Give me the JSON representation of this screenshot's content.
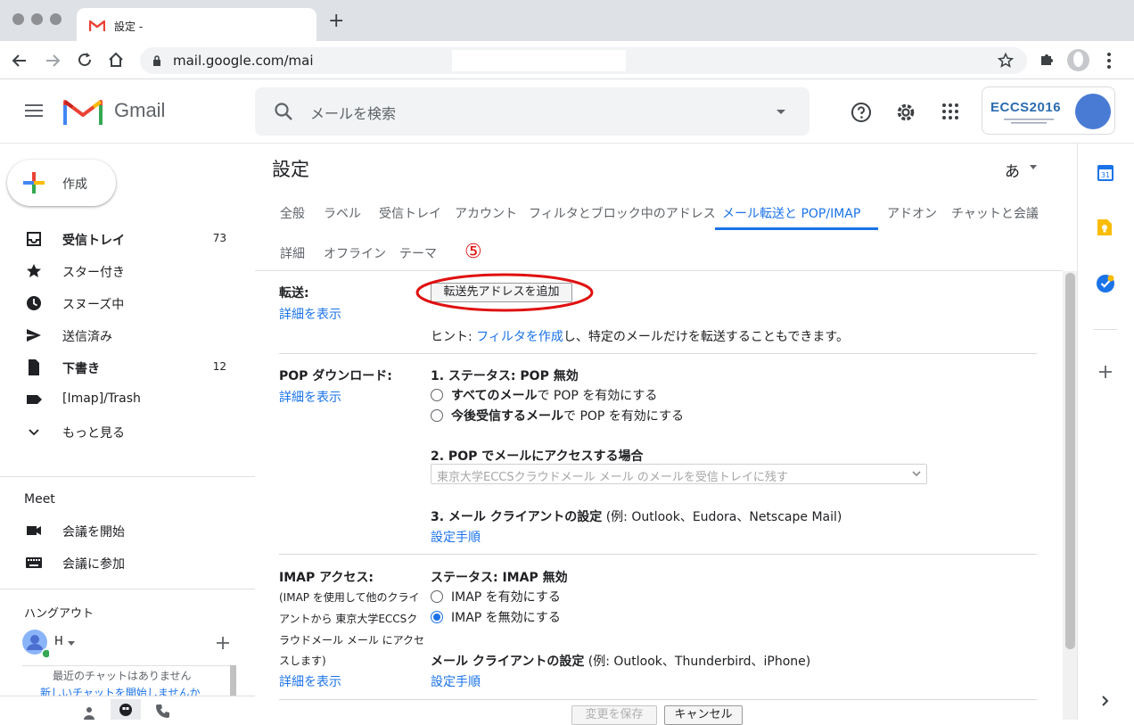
{
  "browser": {
    "tab_title": "設定 -",
    "new_tab": "+",
    "url": "mail.google.com/mai"
  },
  "gmail": {
    "product_name": "Gmail",
    "search_placeholder": "メールを検索",
    "account_logo_text": "ECCS2016",
    "colors": {
      "accent": "#1a73e8",
      "red_marker": "#e01010",
      "gmail_red": "#ea4335"
    }
  },
  "sidebar": {
    "compose_label": "作成",
    "items": [
      {
        "icon": "inbox-icon",
        "label": "受信トレイ",
        "count": "73",
        "bold": true
      },
      {
        "icon": "star-icon",
        "label": "スター付き",
        "count": ""
      },
      {
        "icon": "clock-icon",
        "label": "スヌーズ中",
        "count": ""
      },
      {
        "icon": "send-icon",
        "label": "送信済み",
        "count": ""
      },
      {
        "icon": "draft-icon",
        "label": "下書き",
        "count": "12",
        "bold": true
      },
      {
        "icon": "label-icon",
        "label": "[Imap]/Trash",
        "count": ""
      },
      {
        "icon": "chevron-down-icon",
        "label": "もっと見る",
        "count": ""
      }
    ],
    "meet_title": "Meet",
    "meet_items": [
      "会議を開始",
      "会議に参加"
    ],
    "hangouts_title": "ハングアウト",
    "hangouts_user": "H",
    "chat_empty": "最近のチャットはありません",
    "chat_start": "新しいチャットを開始しませんか"
  },
  "settings": {
    "title": "設定",
    "lang_icon": "あ",
    "tabs_row1": [
      "全般",
      "ラベル",
      "受信トレイ",
      "アカウント",
      "フィルタとブロック中のアドレス",
      "メール転送と POP/IMAP",
      "アドオン",
      "チャットと会議"
    ],
    "tabs_row2": [
      "詳細",
      "オフライン",
      "テーマ"
    ],
    "active_tab": "メール転送と POP/IMAP",
    "step_marker": "⑤",
    "forwarding": {
      "label": "転送:",
      "details_link": "詳細を表示",
      "add_button": "転送先アドレスを追加",
      "hint_prefix": "ヒント: ",
      "hint_link": "フィルタを作成",
      "hint_suffix": "し、特定のメールだけを転送することもできます。"
    },
    "pop": {
      "label": "POP ダウンロード:",
      "details_link": "詳細を表示",
      "status": "1. ステータス: POP 無効",
      "option1_bold": "すべてのメール",
      "option1_rest": "で POP を有効にする",
      "option2_bold": "今後受信するメール",
      "option2_rest": "で POP を有効にする",
      "access_heading": "2. POP でメールにアクセスする場合",
      "access_select": "東京大学ECCSクラウドメール メール のメールを受信トレイに残す",
      "client_heading_bold": "3. メール クライアントの設定",
      "client_heading_rest": " (例: Outlook、Eudora、Netscape Mail)",
      "client_link": "設定手順"
    },
    "imap": {
      "label": "IMAP アクセス:",
      "desc": [
        "(IMAP を使用して他のクライ",
        "アントから 東京大学ECCSク",
        "ラウドメール メール にアクセ",
        "スします)"
      ],
      "details_link": "詳細を表示",
      "status": "ステータス: IMAP 無効",
      "option_enable": "IMAP を有効にする",
      "option_disable": "IMAP を無効にする",
      "selected": "disable",
      "client_heading_bold": "メール クライアントの設定",
      "client_heading_rest": " (例: Outlook、Thunderbird、iPhone)",
      "client_link": "設定手順"
    },
    "save_button": "変更を保存",
    "cancel_button": "キャンセル"
  }
}
